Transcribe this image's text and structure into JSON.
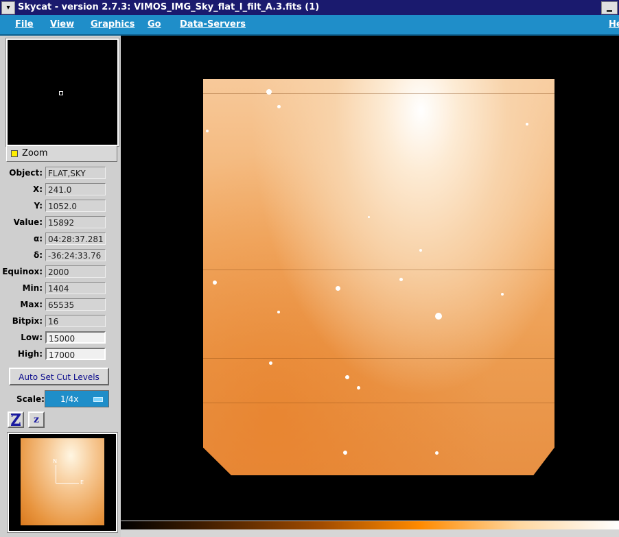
{
  "window": {
    "title": "Skycat - version 2.7.3: VIMOS_IMG_Sky_flat_I_filt_A.3.fits (1)",
    "system_menu_icon": "chevron-down-icon",
    "minimize_icon": "minimize-icon"
  },
  "menubar": {
    "items": [
      "File",
      "View",
      "Graphics",
      "Go",
      "Data-Servers"
    ],
    "help": "He"
  },
  "zoom": {
    "label": "Zoom"
  },
  "info": {
    "object": {
      "label": "Object:",
      "value": "FLAT,SKY"
    },
    "x": {
      "label": "X:",
      "value": "241.0"
    },
    "y": {
      "label": "Y:",
      "value": "1052.0"
    },
    "value": {
      "label": "Value:",
      "value": "15892"
    },
    "alpha": {
      "label": "α:",
      "value": "04:28:37.281"
    },
    "delta": {
      "label": "δ:",
      "value": "-36:24:33.76"
    },
    "equinox": {
      "label": "Equinox:",
      "value": "2000"
    },
    "min": {
      "label": "Min:",
      "value": "1404"
    },
    "max": {
      "label": "Max:",
      "value": "65535"
    },
    "bitpix": {
      "label": "Bitpix:",
      "value": "16"
    },
    "low": {
      "label": "Low:",
      "value": "15000"
    },
    "high": {
      "label": "High:",
      "value": "17000"
    }
  },
  "cut_levels": {
    "label": "Auto Set Cut Levels"
  },
  "scale": {
    "label": "Scale:",
    "value": "1/4x"
  },
  "zoom_buttons": {
    "zoom_in": "Z",
    "zoom_out": "z"
  },
  "compass": {
    "north": "N",
    "east": "E"
  },
  "colors": {
    "menubar": "#1f8ec9",
    "titlebar": "#1a1a6e",
    "image_orange": "#f2ae6a"
  }
}
